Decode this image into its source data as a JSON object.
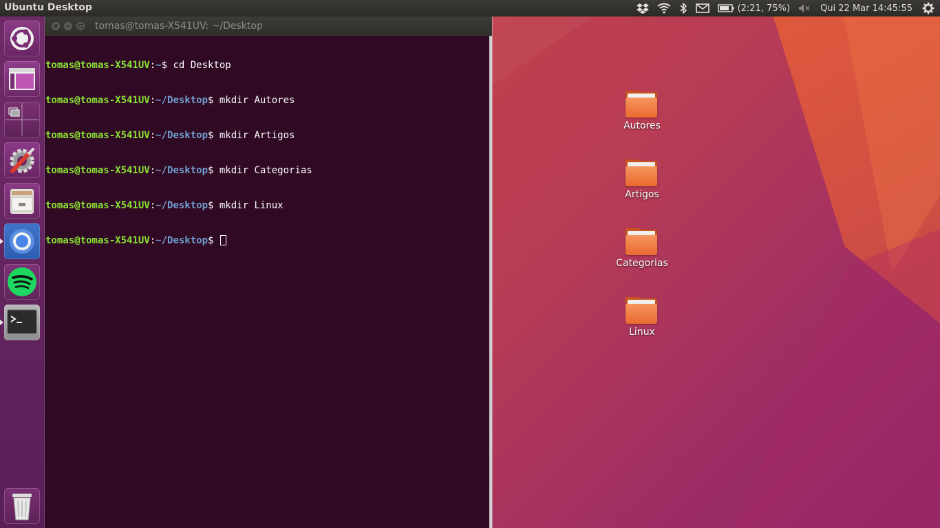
{
  "top_panel": {
    "title": "Ubuntu Desktop",
    "battery_text": "(2:21, 75%)",
    "clock": "Qui 22 Mar 14:45:55"
  },
  "launcher": {
    "items": [
      {
        "name": "dash-home",
        "icon": "ubuntu-logo-icon"
      },
      {
        "name": "window-app",
        "icon": "window-icon"
      },
      {
        "name": "workspace-switcher",
        "icon": "workspace-switcher-icon"
      },
      {
        "name": "system-settings",
        "icon": "settings-wrench-icon"
      },
      {
        "name": "files",
        "icon": "file-cabinet-icon"
      },
      {
        "name": "chrome",
        "icon": "chrome-icon"
      },
      {
        "name": "spotify",
        "icon": "spotify-icon"
      },
      {
        "name": "terminal",
        "icon": "terminal-icon"
      },
      {
        "name": "trash",
        "icon": "trash-icon"
      }
    ]
  },
  "terminal": {
    "title": "tomas@tomas-X541UV: ~/Desktop",
    "lines": [
      {
        "user": "tomas@tomas-X541UV",
        "sep": ":",
        "path": "~",
        "prompt": "$ ",
        "cmd": "cd Desktop"
      },
      {
        "user": "tomas@tomas-X541UV",
        "sep": ":",
        "path": "~/Desktop",
        "prompt": "$ ",
        "cmd": "mkdir Autores"
      },
      {
        "user": "tomas@tomas-X541UV",
        "sep": ":",
        "path": "~/Desktop",
        "prompt": "$ ",
        "cmd": "mkdir Artigos"
      },
      {
        "user": "tomas@tomas-X541UV",
        "sep": ":",
        "path": "~/Desktop",
        "prompt": "$ ",
        "cmd": "mkdir Categorias"
      },
      {
        "user": "tomas@tomas-X541UV",
        "sep": ":",
        "path": "~/Desktop",
        "prompt": "$ ",
        "cmd": "mkdir Linux"
      },
      {
        "user": "tomas@tomas-X541UV",
        "sep": ":",
        "path": "~/Desktop",
        "prompt": "$ ",
        "cmd": ""
      }
    ]
  },
  "desktop": {
    "icons": [
      {
        "label": "Autores"
      },
      {
        "label": "Artigos"
      },
      {
        "label": "Categorias"
      },
      {
        "label": "Linux"
      }
    ]
  },
  "colors": {
    "terminal_bg": "#300a24",
    "prompt_user": "#8ae234",
    "prompt_path": "#729fcf",
    "launcher_bg": "#6e2a67",
    "folder_orange": "#ea6a30"
  }
}
